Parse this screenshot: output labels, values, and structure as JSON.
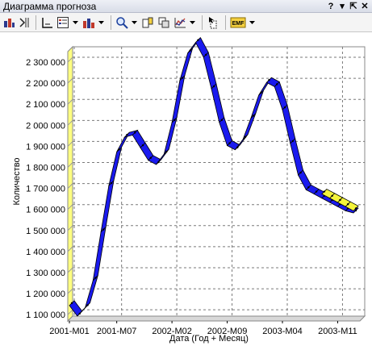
{
  "window": {
    "title": "Диаграмма прогноза",
    "buttons": [
      "?",
      "▾",
      "⇱",
      "✕"
    ]
  },
  "toolbar": {
    "items": [
      {
        "icon": "chart-wizard-icon"
      },
      {
        "icon": "chart-options-icon"
      },
      {
        "icon": "axis-icon"
      },
      {
        "icon": "legend-icon"
      },
      {
        "icon": "chart-type-icon"
      },
      {
        "icon": "zoom-icon"
      },
      {
        "icon": "copy-chart-icon"
      },
      {
        "icon": "paste-chart-icon"
      },
      {
        "icon": "trend-icon"
      },
      {
        "icon": "cursor-icon"
      },
      {
        "icon": "export-emf-icon",
        "label": "EMF"
      }
    ]
  },
  "chart_data": {
    "type": "line",
    "xlabel": "Дата (Год + Месяц)",
    "ylabel": "Количество",
    "x_ticks": [
      "2001-M01",
      "2001-M07",
      "2002-M02",
      "2002-M09",
      "2003-M04",
      "2003-M11"
    ],
    "y_ticks": [
      "1 100 000",
      "1 200 000",
      "1 300 000",
      "1 400 000",
      "1 500 000",
      "1 600 000",
      "1 700 000",
      "1 800 000",
      "1 900 000",
      "2 000 000",
      "2 100 000",
      "2 200 000",
      "2 300 000"
    ],
    "ylim": [
      1070000,
      2350000
    ],
    "grid": true,
    "style": "3d-ribbon",
    "series": [
      {
        "color": "#1a1aee",
        "x": [
          "2001-M01",
          "2001-M02",
          "2001-M03",
          "2001-M04",
          "2001-M05",
          "2001-M06",
          "2001-M07",
          "2001-M08",
          "2001-M09",
          "2001-M10",
          "2001-M11",
          "2001-M12",
          "2002-M01",
          "2002-M02",
          "2002-M03",
          "2002-M04",
          "2002-M05",
          "2002-M06",
          "2002-M07",
          "2002-M08",
          "2002-M09",
          "2002-M10",
          "2002-M11",
          "2002-M12",
          "2003-M01",
          "2003-M02",
          "2003-M03",
          "2003-M04",
          "2003-M05",
          "2003-M06",
          "2003-M07",
          "2003-M08",
          "2003-M09",
          "2003-M10",
          "2003-M11",
          "2003-M12",
          "2004-M01"
        ],
        "values": [
          1130000,
          1080000,
          1120000,
          1250000,
          1480000,
          1700000,
          1860000,
          1930000,
          1940000,
          1880000,
          1820000,
          1800000,
          1850000,
          2000000,
          2200000,
          2330000,
          2380000,
          2310000,
          2160000,
          2000000,
          1890000,
          1870000,
          1920000,
          2020000,
          2130000,
          2190000,
          2170000,
          2060000,
          1900000,
          1750000,
          1680000,
          1660000,
          1640000,
          1620000,
          1600000,
          1580000,
          1570000
        ]
      },
      {
        "color": "#f4f43a",
        "x": [
          "2003-M09",
          "2003-M10",
          "2003-M11",
          "2003-M12",
          "2004-M01"
        ],
        "values": [
          1660000,
          1640000,
          1620000,
          1600000,
          1580000
        ]
      }
    ]
  }
}
